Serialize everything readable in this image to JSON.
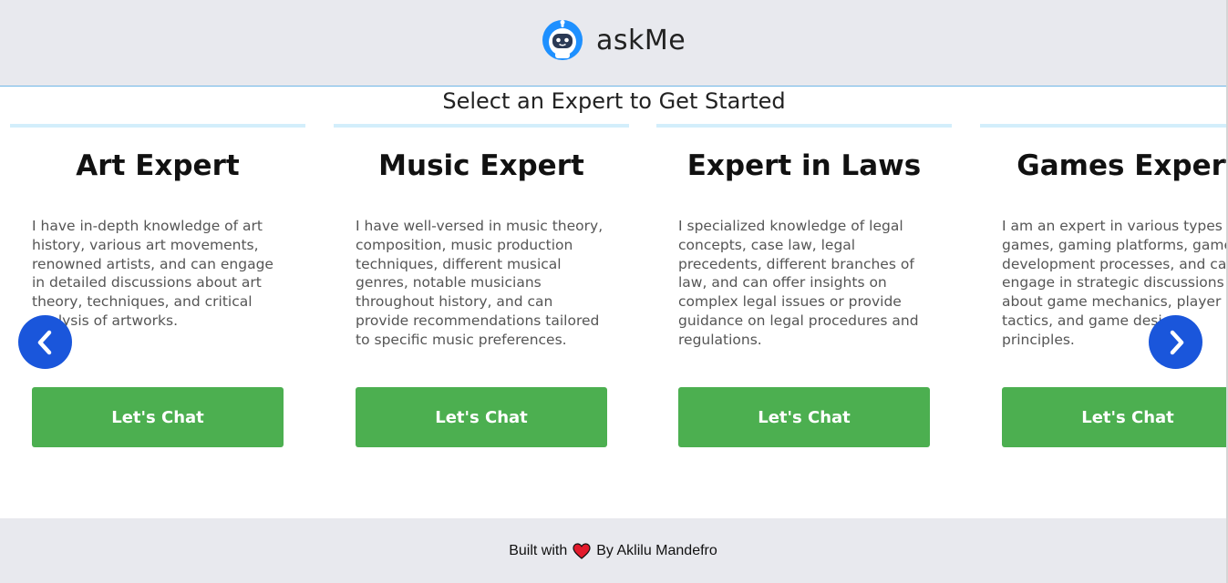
{
  "header": {
    "brand_name": "askMe",
    "logo_icon": "robot-icon"
  },
  "main": {
    "title": "Select an Expert to Get Started"
  },
  "cards": [
    {
      "title": "Art Expert",
      "description": "I have in-depth knowledge of art history, various art movements, renowned artists, and can engage in detailed discussions about art theory, techniques, and critical analysis of artworks.",
      "button_label": "Let's Chat"
    },
    {
      "title": "Music Expert",
      "description": "I have well-versed in music theory, composition, music production techniques, different musical genres, notable musicians throughout history, and can provide recommendations tailored to specific music preferences.",
      "button_label": "Let's Chat"
    },
    {
      "title": "Expert in Laws",
      "description": "I specialized knowledge of legal concepts, case law, legal precedents, different branches of law, and can offer insights on complex legal issues or provide guidance on legal procedures and regulations.",
      "button_label": "Let's Chat"
    },
    {
      "title": "Games Expert",
      "description": "I am an expert in various types of games, gaming platforms, game development processes, and can engage in strategic discussions about game mechanics, player tactics, and game design principles.",
      "button_label": "Let's Chat"
    }
  ],
  "carousel": {
    "prev_icon": "chevron-left-icon",
    "next_icon": "chevron-right-icon"
  },
  "footer": {
    "prefix": "Built with",
    "heart_icon": "heart-icon",
    "suffix": "By Aklilu Mandefro"
  },
  "colors": {
    "accent_button": "#4caf50",
    "nav_button": "#1a56db",
    "header_bg": "#e8e9ee",
    "card_top_border": "#d3eefb",
    "heart": "#e21b2c"
  }
}
